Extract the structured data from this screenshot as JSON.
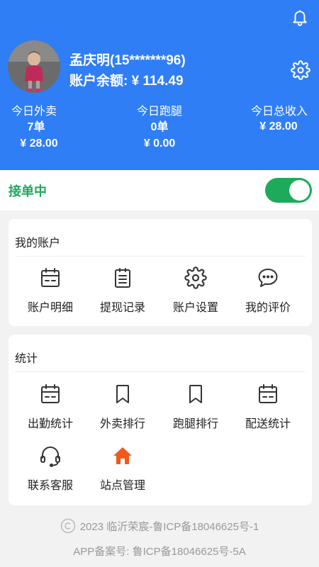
{
  "header": {
    "user_name": "孟庆明(15*******96)",
    "balance_label": "账户余额:",
    "balance_value": "¥ 114.49",
    "stats": [
      {
        "label": "今日外卖",
        "count": "7单",
        "amount": "¥ 28.00"
      },
      {
        "label": "今日跑腿",
        "count": "0单",
        "amount": "¥ 0.00"
      },
      {
        "label": "今日总收入",
        "count": "",
        "amount": "¥ 28.00"
      }
    ],
    "icons": {
      "notification": "bell-icon",
      "settings": "gear-icon"
    }
  },
  "order_status": {
    "label": "接单中",
    "toggle_on": true,
    "color": "#1daa5a"
  },
  "account_section": {
    "title": "我的账户",
    "items": [
      {
        "label": "账户明细",
        "icon": "calendar-icon"
      },
      {
        "label": "提现记录",
        "icon": "clipboard-icon"
      },
      {
        "label": "账户设置",
        "icon": "gear-icon"
      },
      {
        "label": "我的评价",
        "icon": "chat-bubble-icon"
      }
    ]
  },
  "stats_section": {
    "title": "统计",
    "items": [
      {
        "label": "出勤统计",
        "icon": "calendar-icon"
      },
      {
        "label": "外卖排行",
        "icon": "bookmark-icon"
      },
      {
        "label": "跑腿排行",
        "icon": "bookmark-icon"
      },
      {
        "label": "配送统计",
        "icon": "calendar-icon"
      },
      {
        "label": "联系客服",
        "icon": "headset-icon"
      },
      {
        "label": "站点管理",
        "icon": "home-icon"
      }
    ]
  },
  "footer": {
    "copyright": "2023 临沂荣宸-鲁ICP备18046625号-1",
    "app_record": "APP备案号: 鲁ICP备18046625号-5A"
  },
  "colors": {
    "header_bg": "#2f7ef5",
    "accent_green": "#1daa5a",
    "home_icon": "#f25a1c"
  }
}
